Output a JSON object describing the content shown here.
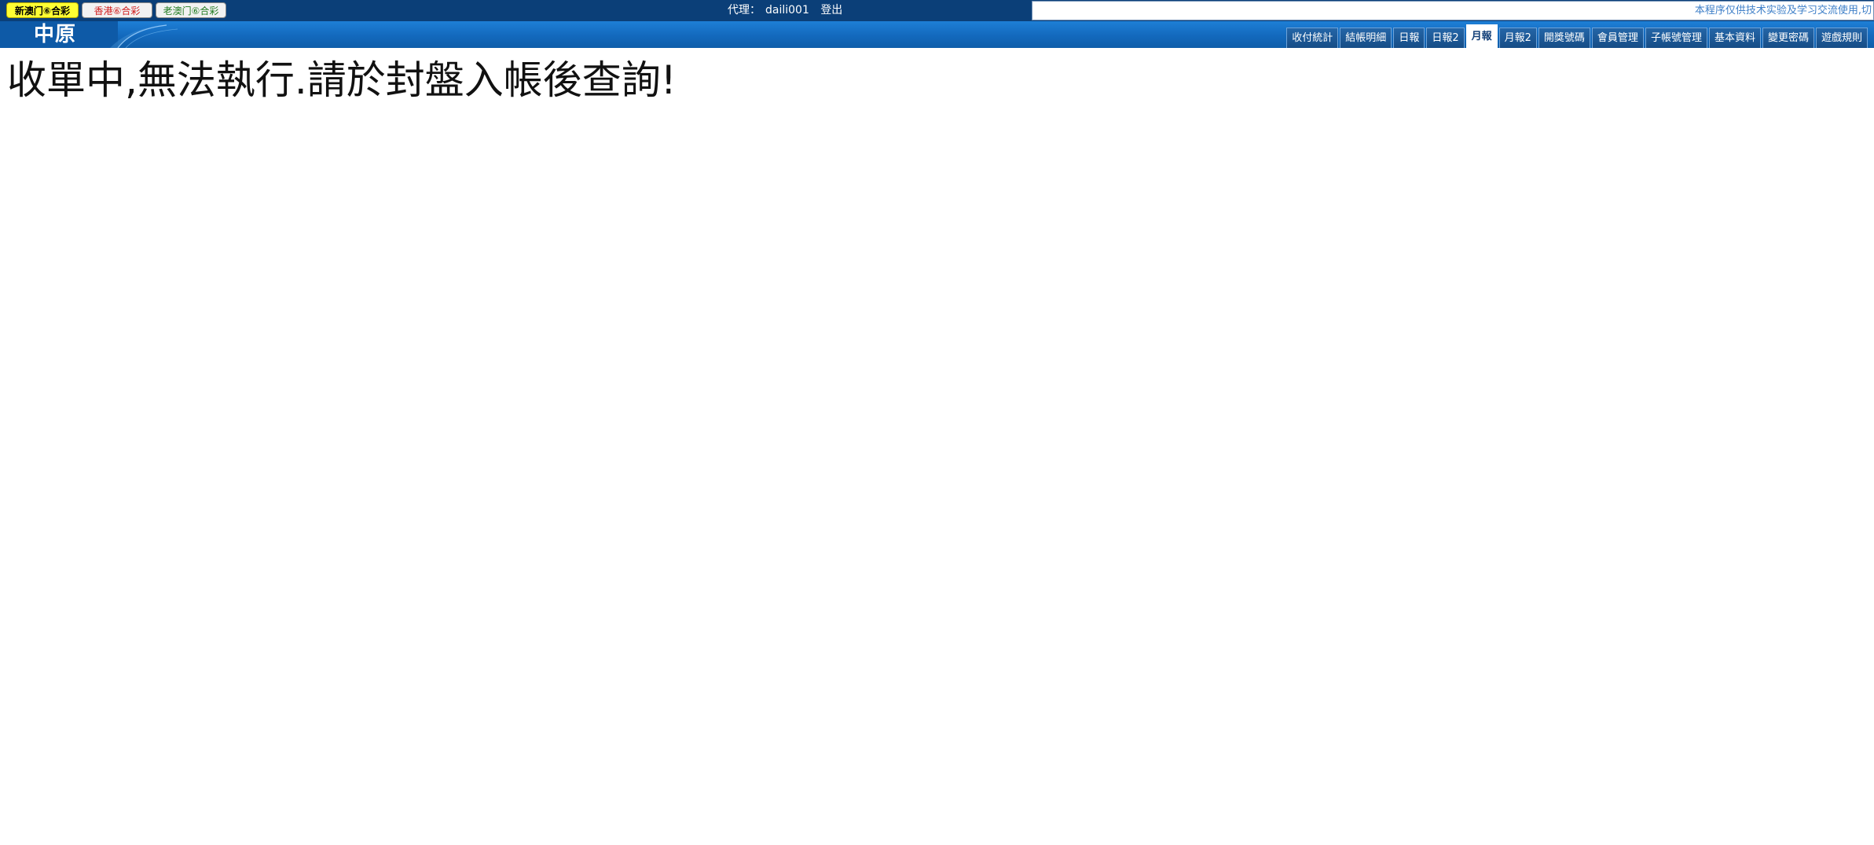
{
  "topbar": {
    "lottery_tabs": [
      {
        "label": "新澳门⑥合彩"
      },
      {
        "label": "香港⑥合彩"
      },
      {
        "label": "老澳门⑥合彩"
      }
    ],
    "agent_label": "代理：",
    "agent_name": "daili001",
    "logout_label": "登出",
    "notice": "本程序仅供技术实验及学习交流使用,切"
  },
  "brand": {
    "name": "中原"
  },
  "nav": {
    "tabs": [
      {
        "label": "收付統計"
      },
      {
        "label": "結帳明細"
      },
      {
        "label": "日報"
      },
      {
        "label": "日報2"
      },
      {
        "label": "月報"
      },
      {
        "label": "月報2"
      },
      {
        "label": "開獎號碼"
      },
      {
        "label": "會員管理"
      },
      {
        "label": "子帳號管理"
      },
      {
        "label": "基本資料"
      },
      {
        "label": "變更密碼"
      },
      {
        "label": "遊戲規則"
      }
    ],
    "active_tab": "月報"
  },
  "content": {
    "message": "收單中,無法執行.請於封盤入帳後查詢!"
  },
  "colors": {
    "topbar_bg": "#0b3f78",
    "nav_bg": "#1369bd",
    "lottery_active_bg": "#ffff33",
    "notice_text": "#3e7fc8"
  }
}
